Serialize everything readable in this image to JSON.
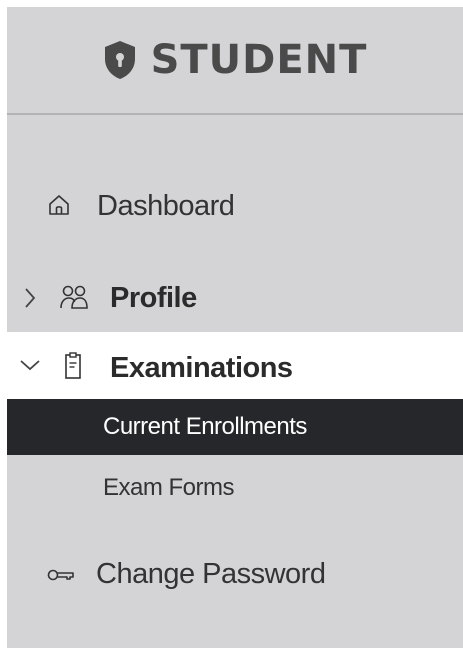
{
  "header": {
    "brand": "STUDENT",
    "logo_icon": "shield-lock-icon"
  },
  "nav": {
    "dashboard": {
      "label": "Dashboard",
      "icon": "home-icon"
    },
    "profile": {
      "label": "Profile",
      "icon": "people-icon",
      "expanded": false
    },
    "examinations": {
      "label": "Examinations",
      "icon": "clipboard-icon",
      "expanded": true,
      "children": [
        {
          "label": "Current Enrollments",
          "active": true
        },
        {
          "label": "Exam Forms",
          "active": false
        }
      ]
    },
    "change_password": {
      "label": "Change Password",
      "icon": "key-icon"
    }
  },
  "colors": {
    "sidebar_bg": "#d4d4d6",
    "active_bg": "#26272b",
    "expanded_bg": "#ffffff",
    "text": "#333333"
  }
}
